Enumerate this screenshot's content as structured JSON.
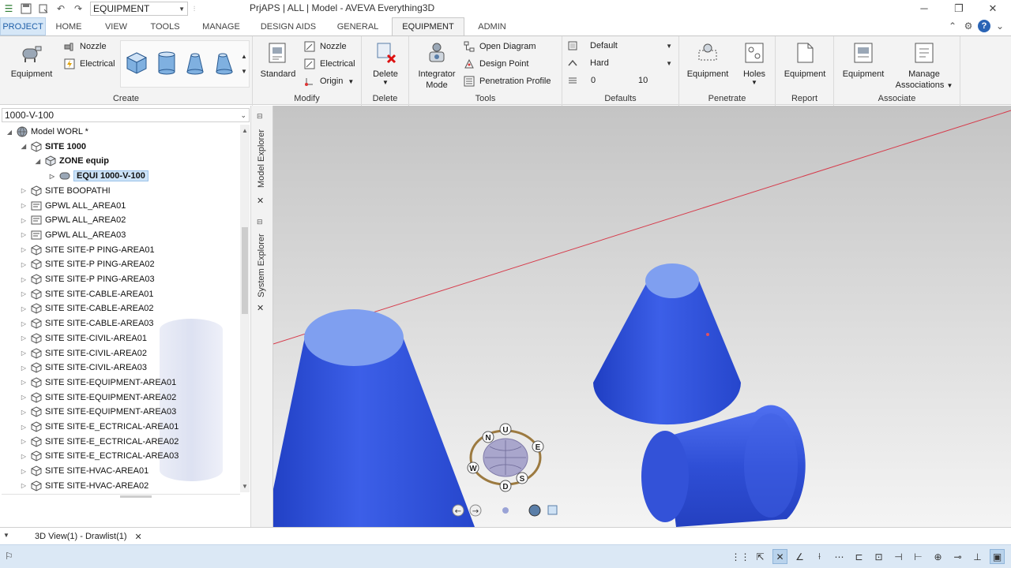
{
  "titlebar": {
    "module": "EQUIPMENT",
    "title": "PrjAPS | ALL | Model - AVEVA Everything3D",
    "icons": [
      "app-icon",
      "save-icon",
      "redo-history-icon",
      "undo-icon",
      "redo-icon"
    ],
    "window_controls": [
      "minimize-icon",
      "restore-icon",
      "close-icon"
    ]
  },
  "tabs": [
    "PROJECT",
    "HOME",
    "VIEW",
    "TOOLS",
    "MANAGE",
    "DESIGN AIDS",
    "GENERAL",
    "EQUIPMENT",
    "ADMIN"
  ],
  "active_tab": "EQUIPMENT",
  "ribbon": {
    "create": {
      "label": "Create",
      "equipment": "Equipment",
      "nozzle": "Nozzle",
      "electrical": "Electrical",
      "primitives": [
        "box",
        "cylinder",
        "cone",
        "snout"
      ]
    },
    "modify": {
      "label": "Modify",
      "standard": "Standard",
      "nozzle": "Nozzle",
      "electrical": "Electrical",
      "origin": "Origin"
    },
    "delete": {
      "label": "Delete",
      "delete": "Delete"
    },
    "tools": {
      "label": "Tools",
      "integrator_line1": "Integrator",
      "integrator_line2": "Mode",
      "open_diagram": "Open Diagram",
      "design_point": "Design Point",
      "penetration_profile": "Penetration Profile"
    },
    "defaults": {
      "label": "Defaults",
      "style": "Default",
      "obstruction": "Hard",
      "level_min": "0",
      "level_max": "10"
    },
    "penetrate": {
      "label": "Penetrate",
      "equipment": "Equipment",
      "holes": "Holes"
    },
    "report": {
      "label": "Report",
      "equipment": "Equipment"
    },
    "associate": {
      "label": "Associate",
      "equipment": "Equipment",
      "manage_line1": "Manage",
      "manage_line2": "Associations"
    }
  },
  "left_panel": {
    "current_element": "1000-V-100",
    "tree": [
      {
        "label": "Model WORL *",
        "level": 0,
        "expanded": true,
        "bold": false,
        "icon": "world-icon"
      },
      {
        "label": "SITE 1000",
        "level": 1,
        "expanded": true,
        "bold": true,
        "icon": "site-icon"
      },
      {
        "label": "ZONE equip",
        "level": 2,
        "expanded": true,
        "bold": true,
        "icon": "zone-icon"
      },
      {
        "label": "EQUI 1000-V-100",
        "level": 3,
        "expanded": false,
        "bold": true,
        "selected": true,
        "icon": "equipment-icon"
      },
      {
        "label": "SITE BOOPATHI",
        "level": 1,
        "expanded": false,
        "bold": false,
        "icon": "site-icon"
      },
      {
        "label": "GPWL ALL_AREA01",
        "level": 1,
        "expanded": false,
        "bold": false,
        "icon": "gpwl-icon"
      },
      {
        "label": "GPWL ALL_AREA02",
        "level": 1,
        "expanded": false,
        "bold": false,
        "icon": "gpwl-icon"
      },
      {
        "label": "GPWL ALL_AREA03",
        "level": 1,
        "expanded": false,
        "bold": false,
        "icon": "gpwl-icon"
      },
      {
        "label": "SITE SITE-P PING-AREA01",
        "level": 1,
        "expanded": false,
        "bold": false,
        "icon": "site-icon"
      },
      {
        "label": "SITE SITE-P PING-AREA02",
        "level": 1,
        "expanded": false,
        "bold": false,
        "icon": "site-icon"
      },
      {
        "label": "SITE SITE-P PING-AREA03",
        "level": 1,
        "expanded": false,
        "bold": false,
        "icon": "site-icon"
      },
      {
        "label": "SITE SITE-CABLE-AREA01",
        "level": 1,
        "expanded": false,
        "bold": false,
        "icon": "site-icon"
      },
      {
        "label": "SITE SITE-CABLE-AREA02",
        "level": 1,
        "expanded": false,
        "bold": false,
        "icon": "site-icon"
      },
      {
        "label": "SITE SITE-CABLE-AREA03",
        "level": 1,
        "expanded": false,
        "bold": false,
        "icon": "site-icon"
      },
      {
        "label": "SITE SITE-CIVIL-AREA01",
        "level": 1,
        "expanded": false,
        "bold": false,
        "icon": "site-icon"
      },
      {
        "label": "SITE SITE-CIVIL-AREA02",
        "level": 1,
        "expanded": false,
        "bold": false,
        "icon": "site-icon"
      },
      {
        "label": "SITE SITE-CIVIL-AREA03",
        "level": 1,
        "expanded": false,
        "bold": false,
        "icon": "site-icon"
      },
      {
        "label": "SITE SITE-EQUIPMENT-AREA01",
        "level": 1,
        "expanded": false,
        "bold": false,
        "icon": "site-icon"
      },
      {
        "label": "SITE SITE-EQUIPMENT-AREA02",
        "level": 1,
        "expanded": false,
        "bold": false,
        "icon": "site-icon"
      },
      {
        "label": "SITE SITE-EQUIPMENT-AREA03",
        "level": 1,
        "expanded": false,
        "bold": false,
        "icon": "site-icon"
      },
      {
        "label": "SITE SITE-E_ECTRICAL-AREA01",
        "level": 1,
        "expanded": false,
        "bold": false,
        "icon": "site-icon"
      },
      {
        "label": "SITE SITE-E_ECTRICAL-AREA02",
        "level": 1,
        "expanded": false,
        "bold": false,
        "icon": "site-icon"
      },
      {
        "label": "SITE SITE-E_ECTRICAL-AREA03",
        "level": 1,
        "expanded": false,
        "bold": false,
        "icon": "site-icon"
      },
      {
        "label": "SITE SITE-HVAC-AREA01",
        "level": 1,
        "expanded": false,
        "bold": false,
        "icon": "site-icon"
      },
      {
        "label": "SITE SITE-HVAC-AREA02",
        "level": 1,
        "expanded": false,
        "bold": false,
        "icon": "site-icon"
      }
    ]
  },
  "side_tabs": [
    "Model Explorer",
    "System Explorer"
  ],
  "viewport": {
    "compass": {
      "up": "U",
      "north": "N",
      "east": "E",
      "west": "W",
      "south": "S",
      "down": "D"
    },
    "colors": {
      "primitive": "#2f4fd6",
      "primitive_top": "#7f9ff0",
      "background_top": "#c4c4c4",
      "background_bottom": "#f4f4f4",
      "axis_line": "#d63a4a"
    }
  },
  "document_tab": {
    "label": "3D View(1) - Drawlist(1)"
  },
  "statusbar": {
    "left_icon": "flag-icon",
    "icons": [
      "snap-grid-icon",
      "snap-pointer-icon",
      "snap-cancel-icon",
      "snap-angle-icon",
      "snap-line-icon",
      "snap-path-icon",
      "snap-edge-icon",
      "snap-face-icon",
      "snap-end-icon",
      "snap-mid-icon",
      "snap-center-icon",
      "snap-node-icon",
      "snap-bottom-icon",
      "snap-box-icon"
    ]
  }
}
